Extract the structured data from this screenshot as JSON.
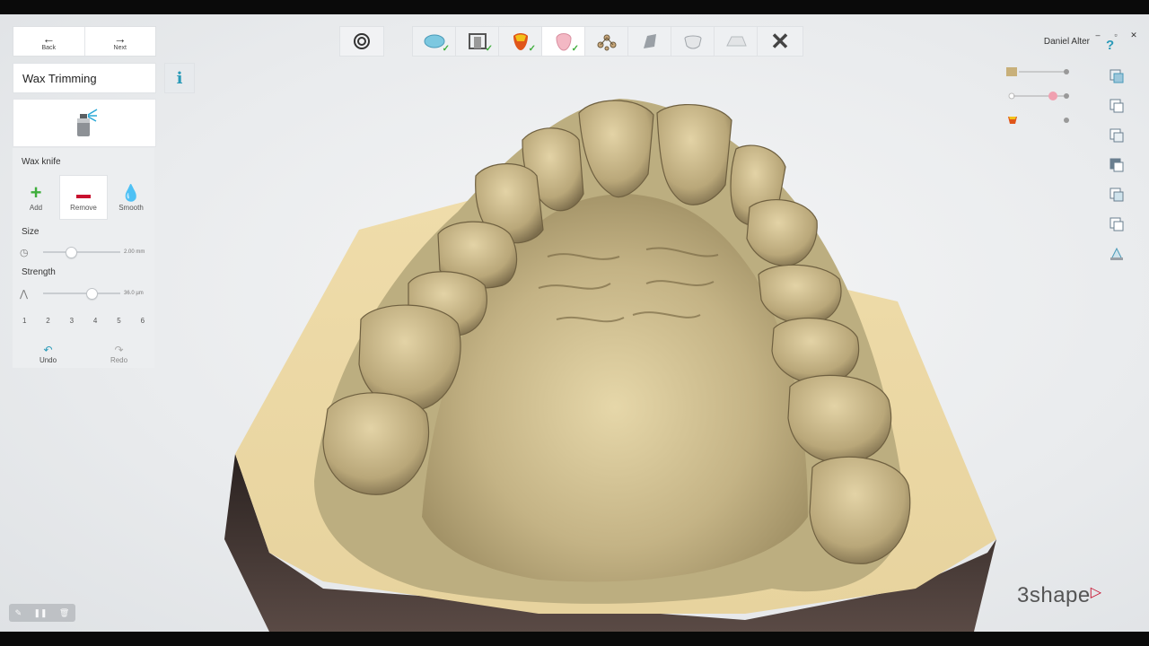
{
  "user_name": "Daniel Alter",
  "nav": {
    "back": "Back",
    "next": "Next"
  },
  "step_title": "Wax Trimming",
  "info_label": "i",
  "tool": {
    "name": "Wax knife",
    "modes": [
      {
        "label": "Add",
        "icon": "plus-icon",
        "color": "#3fae3c"
      },
      {
        "label": "Remove",
        "icon": "minus-icon",
        "color": "#c8102e"
      },
      {
        "label": "Smooth",
        "icon": "drop-icon",
        "color": "#1f5fbf"
      }
    ],
    "selected_mode": "Remove",
    "size_label": "Size",
    "size_value": "2.00 mm",
    "size_fraction": 0.3,
    "strength_label": "Strength",
    "strength_value": "36.0 µm",
    "strength_fraction": 0.6,
    "presets": [
      "1",
      "2",
      "3",
      "4",
      "5",
      "6"
    ]
  },
  "history": {
    "undo": "Undo",
    "redo": "Redo"
  },
  "workflow_steps": [
    {
      "name": "scan-step",
      "done": true
    },
    {
      "name": "model-setup-step",
      "done": true
    },
    {
      "name": "die-step",
      "done": true
    },
    {
      "name": "wax-trimming-step",
      "done": true,
      "active": true
    },
    {
      "name": "connectors-step",
      "done": false
    },
    {
      "name": "die-cut-step",
      "done": false
    },
    {
      "name": "hollow-step",
      "done": false
    },
    {
      "name": "base-step",
      "done": false
    },
    {
      "name": "close-step",
      "done": false
    }
  ],
  "brand": {
    "logo_text": "3shape"
  },
  "colors": {
    "accent": "#2a9ab8",
    "check": "#3fae3c",
    "model": "#d7c9a0",
    "base_dark": "#4a3d38"
  },
  "window_controls": [
    "–",
    "▫",
    "✕"
  ]
}
